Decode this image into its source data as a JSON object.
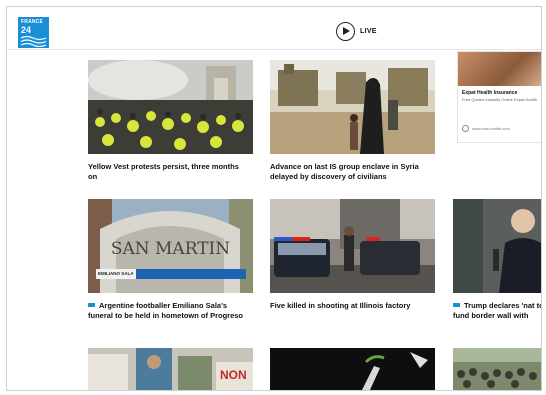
{
  "header": {
    "logo_line1": "FRANCE",
    "logo_line2": "24",
    "live_label": "LIVE"
  },
  "ad": {
    "title": "Expat Health Insurance",
    "text": "Free Quotes Instantly Online Expat Health",
    "url": "www.now-health.com"
  },
  "articles": [
    {
      "caption": "Yellow Vest protests persist, three months on",
      "tagged": false
    },
    {
      "caption": "Advance on last IS group enclave in Syria delayed by discovery of civilians",
      "tagged": false
    },
    {
      "caption": "Argentine footballer Emiliano Sala's funeral to be held in hometown of Progreso",
      "tagged": true,
      "image_sign": "SAN MARTIN",
      "image_strip": "EMILIANO SALA"
    },
    {
      "caption": "Five killed in shooting at Illinois factory",
      "tagged": false
    },
    {
      "caption": "Trump declares 'nat to fund border wall with",
      "tagged": true
    },
    {
      "caption": "",
      "tagged": false,
      "image_sign": "NON"
    },
    {
      "caption": "",
      "tagged": false
    },
    {
      "caption": "",
      "tagged": false
    }
  ]
}
